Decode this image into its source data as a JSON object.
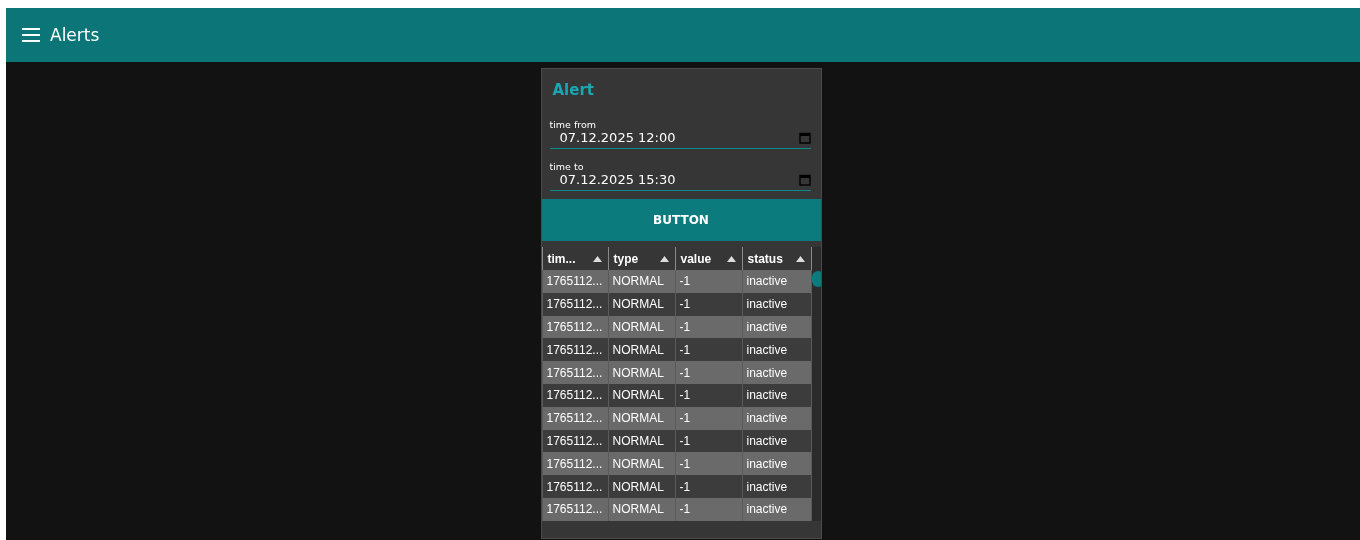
{
  "app_bar": {
    "title": "Alerts"
  },
  "card": {
    "title": "Alert",
    "fields": [
      {
        "label": "time from",
        "value": "07.12.2025 12:00"
      },
      {
        "label": "time to",
        "value": "07.12.2025 15:30"
      }
    ],
    "button": "BUTTON"
  },
  "table": {
    "columns": [
      "tim...",
      "type",
      "value",
      "status"
    ],
    "rows": [
      [
        "1765112...",
        "NORMAL",
        "-1",
        "inactive"
      ],
      [
        "1765112...",
        "NORMAL",
        "-1",
        "inactive"
      ],
      [
        "1765112...",
        "NORMAL",
        "-1",
        "inactive"
      ],
      [
        "1765112...",
        "NORMAL",
        "-1",
        "inactive"
      ],
      [
        "1765112...",
        "NORMAL",
        "-1",
        "inactive"
      ],
      [
        "1765112...",
        "NORMAL",
        "-1",
        "inactive"
      ],
      [
        "1765112...",
        "NORMAL",
        "-1",
        "inactive"
      ],
      [
        "1765112...",
        "NORMAL",
        "-1",
        "inactive"
      ],
      [
        "1765112...",
        "NORMAL",
        "-1",
        "inactive"
      ],
      [
        "1765112...",
        "NORMAL",
        "-1",
        "inactive"
      ],
      [
        "1765112...",
        "NORMAL",
        "-1",
        "inactive"
      ]
    ]
  }
}
